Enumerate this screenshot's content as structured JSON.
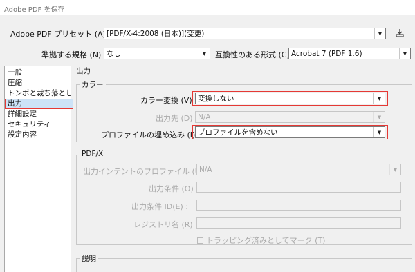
{
  "window": {
    "title": "Adobe PDF を保存"
  },
  "preset": {
    "label": "Adobe PDF プリセット (A) :",
    "value": "[PDF/X-4:2008 (日本)](変更)"
  },
  "standards": {
    "label": "準拠する規格 (N) :",
    "value": "なし",
    "compat_label": "互換性のある形式 (C) :",
    "compat_value": "Acrobat 7 (PDF 1.6)"
  },
  "sidebar": {
    "items": [
      {
        "label": "一般"
      },
      {
        "label": "圧縮"
      },
      {
        "label": "トンボと裁ち落とし"
      },
      {
        "label": "出力"
      },
      {
        "label": "詳細設定"
      },
      {
        "label": "セキュリティ"
      },
      {
        "label": "設定内容"
      }
    ],
    "selected_index": 3
  },
  "main": {
    "section_title": "出力",
    "color_group": {
      "title": "カラー",
      "conversion_label": "カラー変換 (V) :",
      "conversion_value": "変換しない",
      "destination_label": "出力先 (D) :",
      "destination_value": "N/A",
      "profile_label": "プロファイルの埋め込み (I) :",
      "profile_value": "プロファイルを含めない"
    },
    "pdfx_group": {
      "title": "PDF/X",
      "intent_label": "出力インテントのプロファイル (U) :",
      "intent_value": "N/A",
      "condition_label": "出力条件 (O) :",
      "condition_id_label": "出力条件 ID(E) :",
      "registry_label": "レジストリ名 (R) :",
      "trapped_label": "トラッピング済みとしてマーク (T)"
    },
    "description_group": {
      "title": "説明"
    }
  },
  "colors": {
    "highlight": "#e53935",
    "selected_bg": "#cde3f7"
  },
  "icons": {
    "save_preset": "save-preset-icon"
  }
}
